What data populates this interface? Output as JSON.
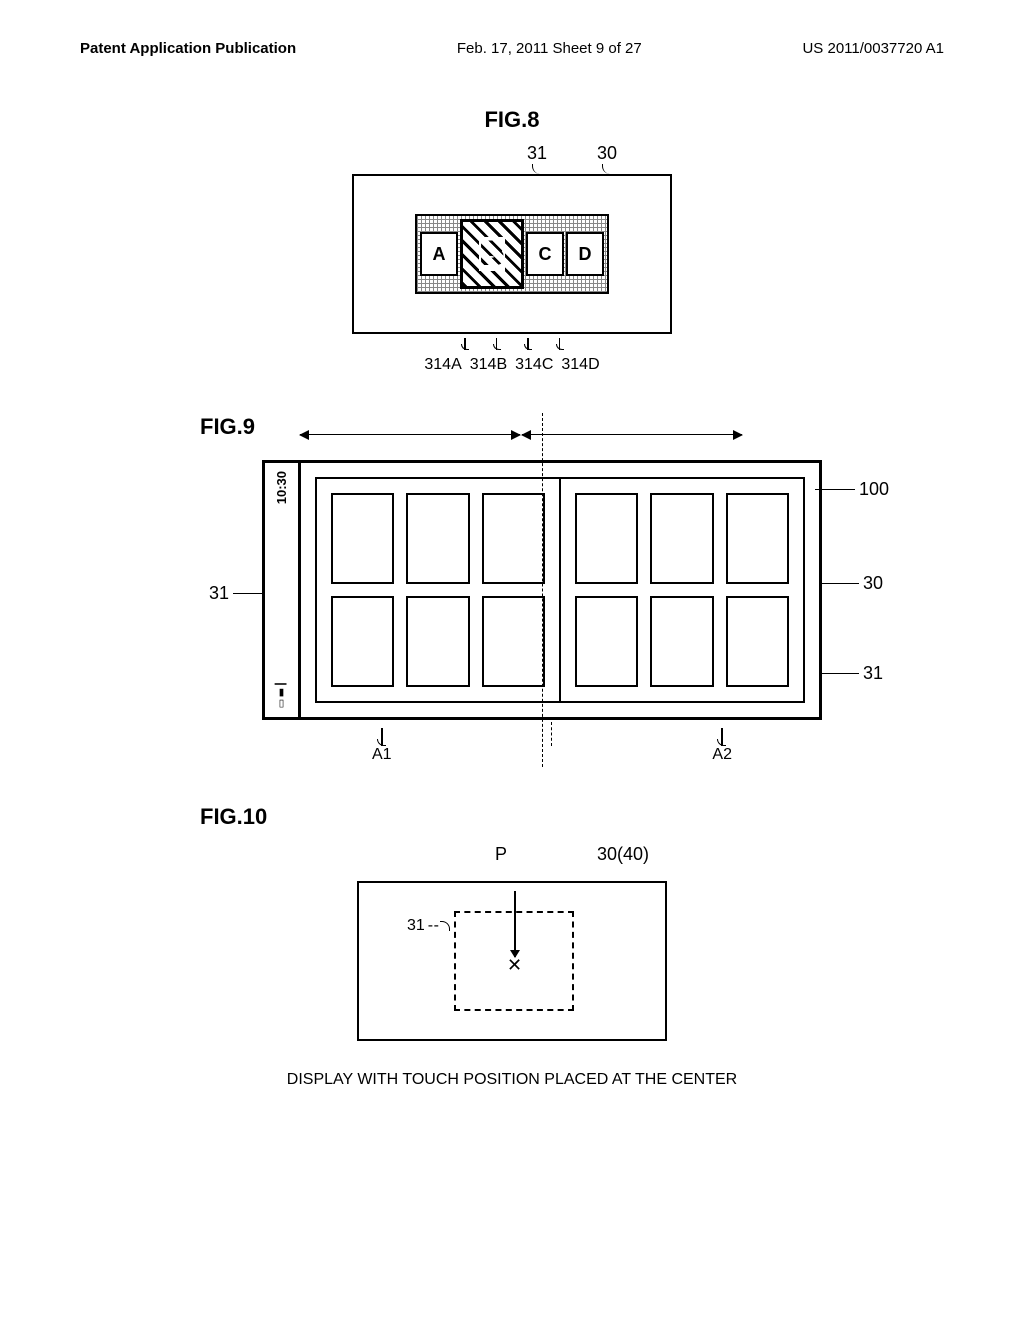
{
  "header": {
    "left": "Patent Application Publication",
    "mid": "Feb. 17, 2011  Sheet 9 of 27",
    "right": "US 2011/0037720 A1"
  },
  "fig8": {
    "label": "FIG.8",
    "ref31": "31",
    "ref30": "30",
    "cells": {
      "a": "A",
      "b": "B",
      "c": "C",
      "d": "D"
    },
    "bottom": {
      "a": "314A",
      "b": "314B",
      "c": "314C",
      "d": "314D"
    }
  },
  "fig9": {
    "label": "FIG.9",
    "time": "10:30",
    "signal": "▯▮┃",
    "ref100": "100",
    "ref30": "30",
    "ref31": "31",
    "a1": "A1",
    "a2": "A2"
  },
  "fig10": {
    "label": "FIG.10",
    "p": "P",
    "ref30_40": "30(40)",
    "ref31": "31",
    "x": "✕",
    "caption": "DISPLAY WITH TOUCH POSITION PLACED AT THE CENTER"
  }
}
